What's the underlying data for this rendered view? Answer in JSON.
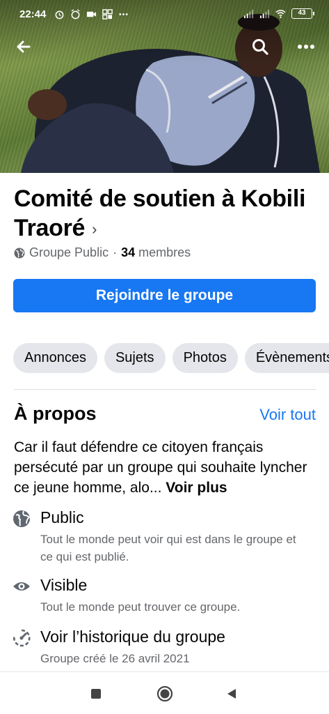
{
  "status_bar": {
    "time": "22:44",
    "battery": "43",
    "icons": [
      "alarm-icon",
      "alarm-clock-icon",
      "video-icon",
      "grid-icon",
      "more-dots-icon",
      "signal-icon",
      "signal-icon",
      "wifi-icon",
      "battery-icon"
    ]
  },
  "header": {
    "back_icon": "back-arrow-icon",
    "search_icon": "search-icon",
    "more_icon": "more-icon"
  },
  "group": {
    "title": "Comité de soutien à Kobili Traoré",
    "title_chevron": "›",
    "privacy": "Groupe Public",
    "separator": "·",
    "member_count": "34",
    "members_label": "membres",
    "join_label": "Rejoindre le groupe"
  },
  "tabs": [
    "Annonces",
    "Sujets",
    "Photos",
    "Évènements"
  ],
  "about": {
    "heading": "À propos",
    "see_all": "Voir tout",
    "description": "Car il faut défendre ce citoyen français persécuté par un groupe qui souhaite lyncher ce jeune homme, alo...",
    "see_more": "Voir plus",
    "items": [
      {
        "icon": "globe-icon",
        "title": "Public",
        "subtitle": "Tout le monde peut voir qui est dans le groupe et ce qui est publié."
      },
      {
        "icon": "eye-icon",
        "title": "Visible",
        "subtitle": "Tout le monde peut trouver ce groupe."
      },
      {
        "icon": "history-icon",
        "title": "Voir l’historique du groupe",
        "subtitle": "Groupe créé le 26 avril 2021"
      }
    ]
  },
  "colors": {
    "accent": "#1877f2",
    "chip_bg": "#e4e6eb",
    "secondary_text": "#65676b"
  }
}
